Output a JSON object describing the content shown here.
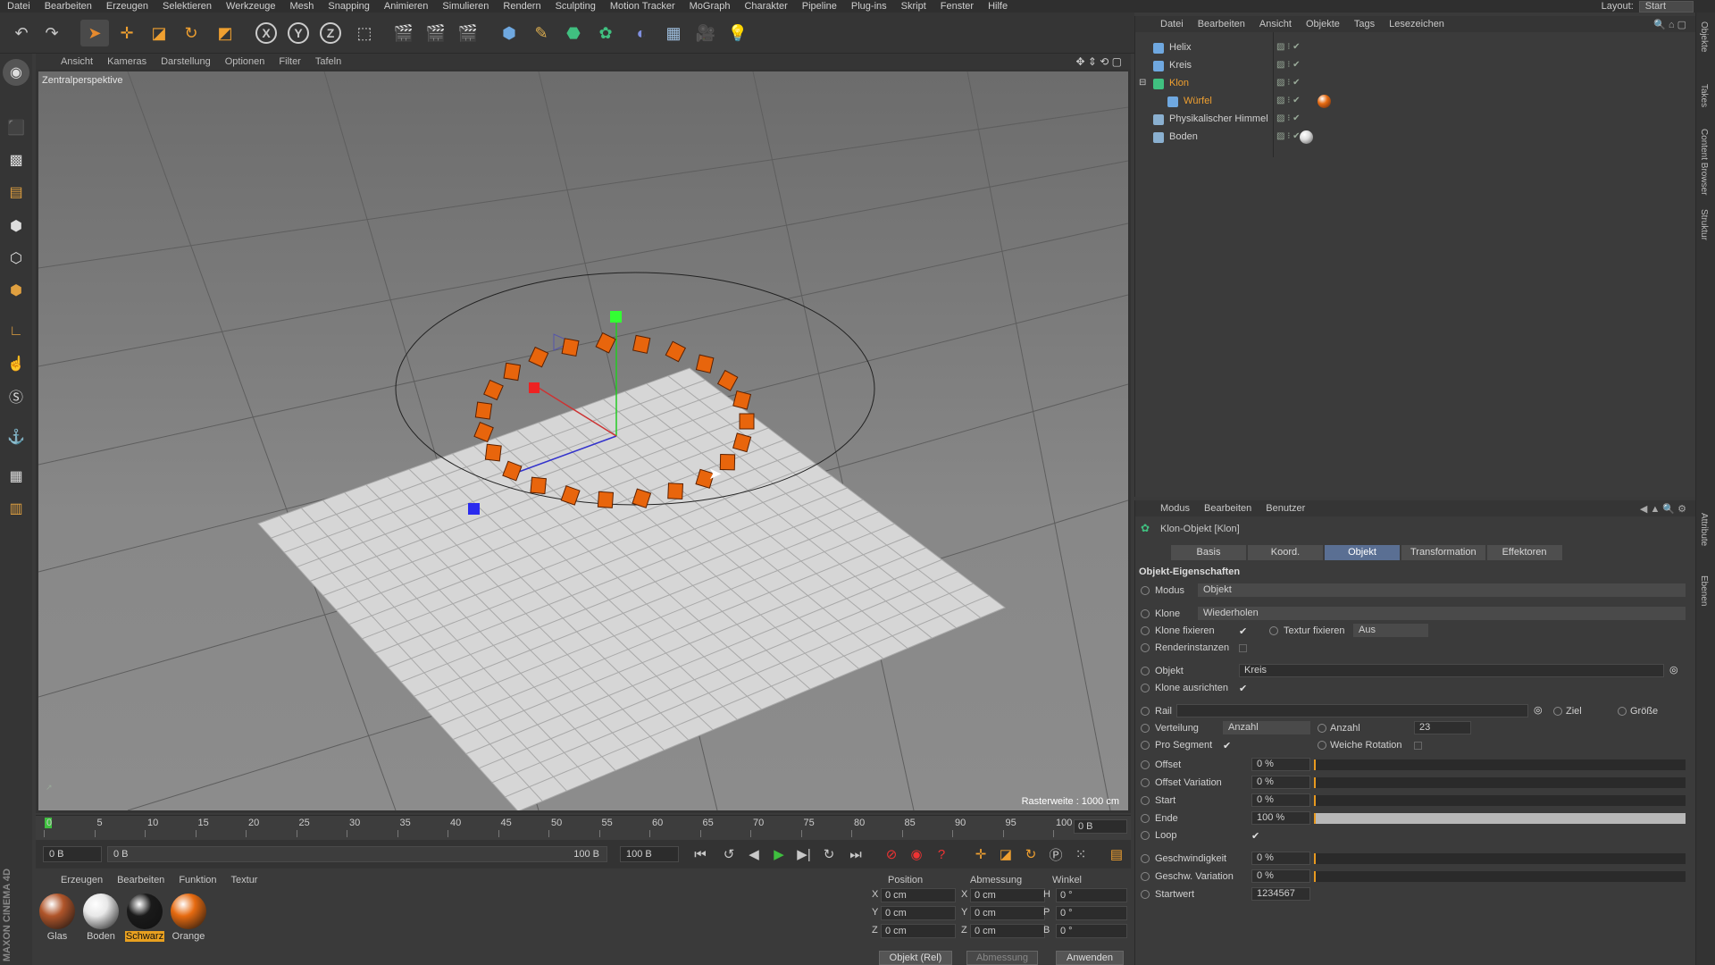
{
  "menubar": {
    "items": [
      "Datei",
      "Bearbeiten",
      "Erzeugen",
      "Selektieren",
      "Werkzeuge",
      "Mesh",
      "Snapping",
      "Animieren",
      "Simulieren",
      "Rendern",
      "Sculpting",
      "Motion Tracker",
      "MoGraph",
      "Charakter",
      "Pipeline",
      "Plug-ins",
      "Skript",
      "Fenster",
      "Hilfe"
    ],
    "layout_label": "Layout:",
    "layout_value": "Start"
  },
  "toolbar": {
    "icons": [
      "undo-icon",
      "redo-icon",
      "select-arrow-icon",
      "move-icon",
      "scale-icon",
      "rotate-icon",
      "last-tool-icon",
      "x-axis-icon",
      "y-axis-icon",
      "z-axis-icon",
      "coord-system-icon",
      "render-view-icon",
      "render-picture-icon",
      "edit-render-settings-icon",
      "cube-icon",
      "pen-icon",
      "subdivision-icon",
      "cloner-icon",
      "deformer-icon",
      "floor-icon",
      "camera-icon",
      "light-icon"
    ],
    "axis_x": "X",
    "axis_y": "Y",
    "axis_z": "Z"
  },
  "viewport": {
    "menu": [
      "Ansicht",
      "Kameras",
      "Darstellung",
      "Optionen",
      "Filter",
      "Tafeln"
    ],
    "label": "Zentralperspektive",
    "raster": "Rasterweite : 1000 cm"
  },
  "timeline": {
    "ticks": [
      "0",
      "5",
      "10",
      "15",
      "20",
      "25",
      "30",
      "35",
      "40",
      "45",
      "50",
      "55",
      "60",
      "65",
      "70",
      "75",
      "80",
      "85",
      "90",
      "95",
      "100"
    ],
    "frame_end_box": "0 B"
  },
  "transport": {
    "start": "0 B",
    "range_start": "0 B",
    "range_end": "100 B",
    "end": "100 B"
  },
  "materials": {
    "menu": [
      "Erzeugen",
      "Bearbeiten",
      "Funktion",
      "Textur"
    ],
    "items": [
      {
        "name": "Glas",
        "color": "#b0552a"
      },
      {
        "name": "Boden",
        "color": "#e8e8e8"
      },
      {
        "name": "Schwarz",
        "color": "#1a1a1a"
      },
      {
        "name": "Orange",
        "color": "#e66a10"
      }
    ]
  },
  "coords": {
    "headers": [
      "Position",
      "Abmessung",
      "Winkel"
    ],
    "rows": [
      {
        "axis": "X",
        "pos": "0 cm",
        "size_axis": "X",
        "size": "0 cm",
        "ang_axis": "H",
        "ang": "0 °"
      },
      {
        "axis": "Y",
        "pos": "0 cm",
        "size_axis": "Y",
        "size": "0 cm",
        "ang_axis": "P",
        "ang": "0 °"
      },
      {
        "axis": "Z",
        "pos": "0 cm",
        "size_axis": "Z",
        "size": "0 cm",
        "ang_axis": "B",
        "ang": "0 °"
      }
    ],
    "mode": "Objekt (Rel)",
    "size_mode": "Abmessung",
    "apply": "Anwenden"
  },
  "objects": {
    "menu": [
      "Datei",
      "Bearbeiten",
      "Ansicht",
      "Objekte",
      "Tags",
      "Lesezeichen"
    ],
    "items": [
      {
        "name": "Helix",
        "color": "#d0d0d0"
      },
      {
        "name": "Kreis",
        "color": "#d0d0d0"
      },
      {
        "name": "Klon",
        "color": "#f0a030"
      },
      {
        "name": "Würfel",
        "color": "#f0a030"
      },
      {
        "name": "Physikalischer Himmel",
        "color": "#d0d0d0"
      },
      {
        "name": "Boden",
        "color": "#d0d0d0"
      }
    ]
  },
  "attributes": {
    "menu": [
      "Modus",
      "Bearbeiten",
      "Benutzer"
    ],
    "title": "Klon-Objekt [Klon]",
    "tabs": [
      "Basis",
      "Koord.",
      "Objekt",
      "Transformation",
      "Effektoren"
    ],
    "section": "Objekt-Eigenschaften",
    "modus_label": "Modus",
    "modus_value": "Objekt",
    "klone_label": "Klone",
    "klone_value": "Wiederholen",
    "klone_fixieren": "Klone fixieren",
    "textur_fixieren": "Textur fixieren",
    "textur_value": "Aus",
    "renderinstanzen": "Renderinstanzen",
    "objekt_label": "Objekt",
    "objekt_value": "Kreis",
    "klone_ausrichten": "Klone ausrichten",
    "rail": "Rail",
    "ziel": "Ziel",
    "groesse": "Größe",
    "verteilung_label": "Verteilung",
    "verteilung_value": "Anzahl",
    "anzahl_label": "Anzahl",
    "anzahl_value": "23",
    "pro_segment": "Pro Segment",
    "weiche_rotation": "Weiche Rotation",
    "offset_label": "Offset",
    "offset_value": "0 %",
    "offset_var_label": "Offset Variation",
    "offset_var_value": "0 %",
    "start_label": "Start",
    "start_value": "0 %",
    "ende_label": "Ende",
    "ende_value": "100 %",
    "ende_fraction": 1.0,
    "loop": "Loop",
    "geschw_label": "Geschwindigkeit",
    "geschw_value": "0 %",
    "geschw_var_label": "Geschw. Variation",
    "geschw_var_value": "0 %",
    "startwert_label": "Startwert",
    "startwert_value": "1234567"
  },
  "sidetabs": [
    "Objekte",
    "Takes",
    "Content Browser",
    "Struktur",
    "Attribute",
    "Ebenen"
  ],
  "brand": "MAXON CINEMA 4D",
  "colors": {
    "accent_tab": "#5a6f93",
    "clone_orange": "#e8650c",
    "selection_orange": "#f0a030"
  }
}
